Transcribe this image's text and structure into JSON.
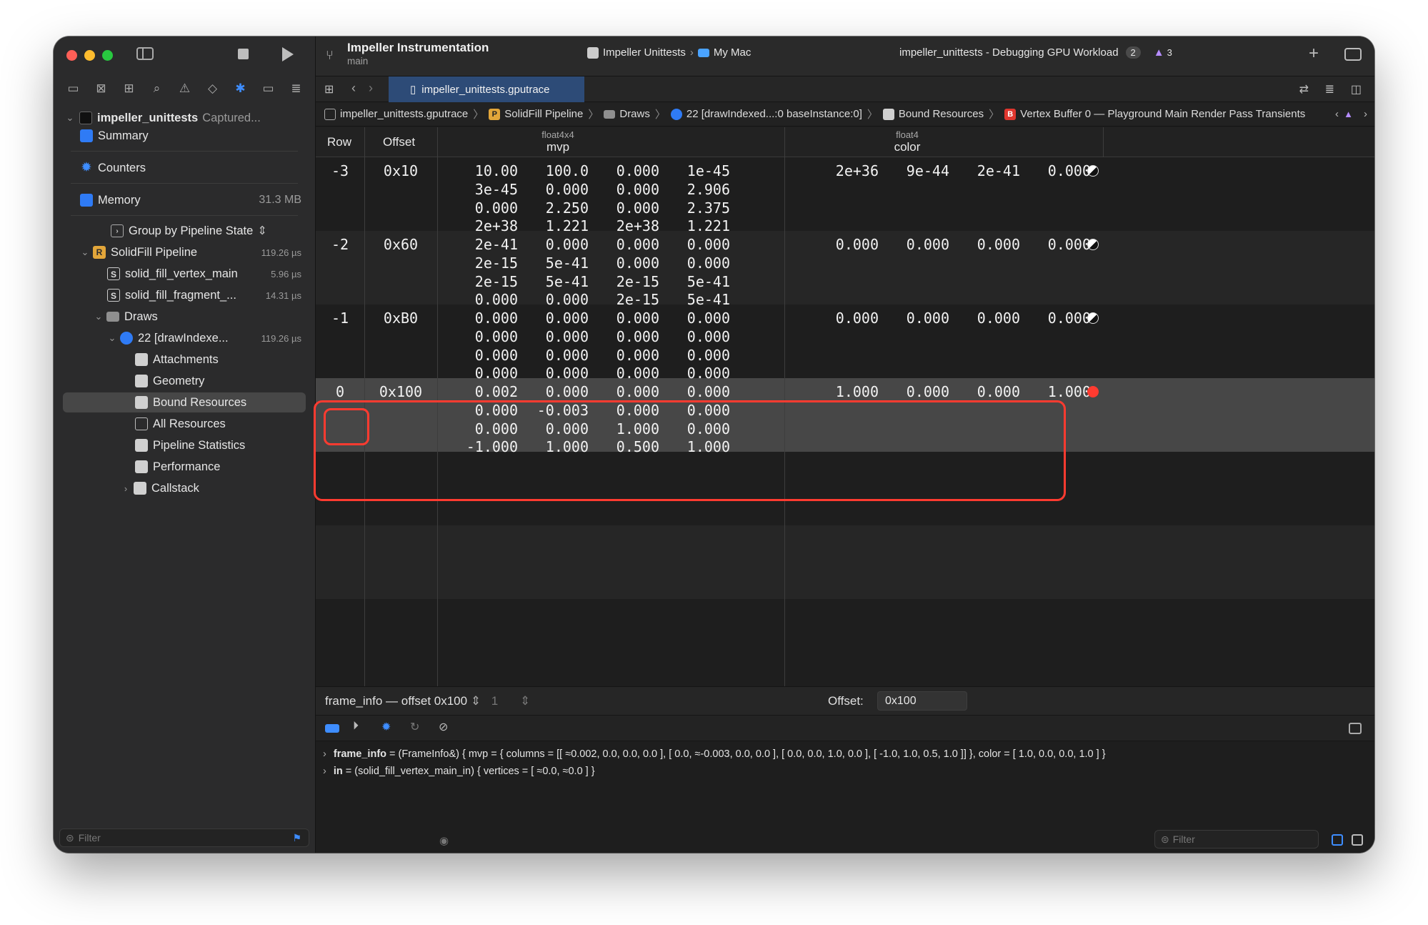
{
  "sidebar": {
    "root_title": "impeller_unittests",
    "root_status": "Captured...",
    "summary": "Summary",
    "counters": "Counters",
    "memory": "Memory",
    "memory_size": "31.3 MB",
    "group_by": "Group by Pipeline State",
    "pipeline": "SolidFill Pipeline",
    "pipeline_time": "119.26 µs",
    "vertex_fn": "solid_fill_vertex_main",
    "vertex_time": "5.96 µs",
    "fragment_fn": "solid_fill_fragment_...",
    "fragment_time": "14.31 µs",
    "draws": "Draws",
    "draw_call": "22 [drawIndexe...",
    "draw_time": "119.26 µs",
    "attachments": "Attachments",
    "geometry": "Geometry",
    "bound_resources": "Bound Resources",
    "all_resources": "All Resources",
    "pipeline_stats": "Pipeline Statistics",
    "performance": "Performance",
    "callstack": "Callstack",
    "filter_placeholder": "Filter"
  },
  "toolbar": {
    "project": "Impeller Instrumentation",
    "branch": "main",
    "scheme": "Impeller Unittests",
    "destination": "My Mac",
    "status": "impeller_unittests - Debugging GPU Workload",
    "badge_count": "2",
    "warning_count": "3"
  },
  "tab": {
    "filename": "impeller_unittests.gputrace"
  },
  "jumpbar": [
    "impeller_unittests.gputrace",
    "SolidFill Pipeline",
    "Draws",
    "22 [drawIndexed...:0 baseInstance:0]",
    "Bound Resources",
    "Vertex Buffer 0 — Playground Main Render Pass Transients"
  ],
  "table": {
    "col_row": "Row",
    "col_offset": "Offset",
    "mvp_type": "float4x4",
    "mvp_name": "mvp",
    "color_type": "float4",
    "color_name": "color",
    "rows": [
      {
        "row": "-3",
        "offset": "0x10",
        "mvp": [
          [
            "10.00",
            "100.0",
            "0.000",
            "1e-45"
          ],
          [
            "3e-45",
            "0.000",
            "0.000",
            "2.906"
          ],
          [
            "0.000",
            "2.250",
            "0.000",
            "2.375"
          ],
          [
            "2e+38",
            "1.221",
            "2e+38",
            "1.221"
          ]
        ],
        "color": [
          "2e+36",
          "9e-44",
          "2e-41",
          "0.000"
        ],
        "swatch": "half"
      },
      {
        "row": "-2",
        "offset": "0x60",
        "mvp": [
          [
            "2e-41",
            "0.000",
            "0.000",
            "0.000"
          ],
          [
            "2e-15",
            "5e-41",
            "0.000",
            "0.000"
          ],
          [
            "2e-15",
            "5e-41",
            "2e-15",
            "5e-41"
          ],
          [
            "0.000",
            "0.000",
            "2e-15",
            "5e-41"
          ]
        ],
        "color": [
          "0.000",
          "0.000",
          "0.000",
          "0.000"
        ],
        "swatch": "half"
      },
      {
        "row": "-1",
        "offset": "0xB0",
        "mvp": [
          [
            "0.000",
            "0.000",
            "0.000",
            "0.000"
          ],
          [
            "0.000",
            "0.000",
            "0.000",
            "0.000"
          ],
          [
            "0.000",
            "0.000",
            "0.000",
            "0.000"
          ],
          [
            "0.000",
            "0.000",
            "0.000",
            "0.000"
          ]
        ],
        "color": [
          "0.000",
          "0.000",
          "0.000",
          "0.000"
        ],
        "swatch": "half"
      },
      {
        "row": "0",
        "offset": "0x100",
        "mvp": [
          [
            "0.002",
            "0.000",
            "0.000",
            "0.000"
          ],
          [
            "0.000",
            "-0.003",
            "0.000",
            "0.000"
          ],
          [
            "0.000",
            "0.000",
            "1.000",
            "0.000"
          ],
          [
            "-1.000",
            "1.000",
            "0.500",
            "1.000"
          ]
        ],
        "color": [
          "1.000",
          "0.000",
          "0.000",
          "1.000"
        ],
        "swatch": "red"
      }
    ]
  },
  "debug": {
    "binding": "frame_info — offset 0x100",
    "stepper": "1",
    "offset_label": "Offset:",
    "offset_value": "0x100"
  },
  "console": {
    "line1_name": "frame_info",
    "line1_rest": " = (FrameInfo&) { mvp = { columns = [[ ≈0.002, 0.0, 0.0, 0.0 ], [ 0.0, ≈-0.003, 0.0, 0.0 ], [ 0.0, 0.0, 1.0, 0.0 ], [ -1.0, 1.0, 0.5, 1.0 ]] }, color = [ 1.0, 0.0, 0.0, 1.0 ] }",
    "line2_name": "in",
    "line2_rest": " = (solid_fill_vertex_main_in) { vertices = [ ≈0.0, ≈0.0 ] }",
    "filter_placeholder": "Filter"
  },
  "colors": {
    "accent": "#3e8dff",
    "highlight": "#ff3b30",
    "swatch_red": "#ff3b30"
  }
}
